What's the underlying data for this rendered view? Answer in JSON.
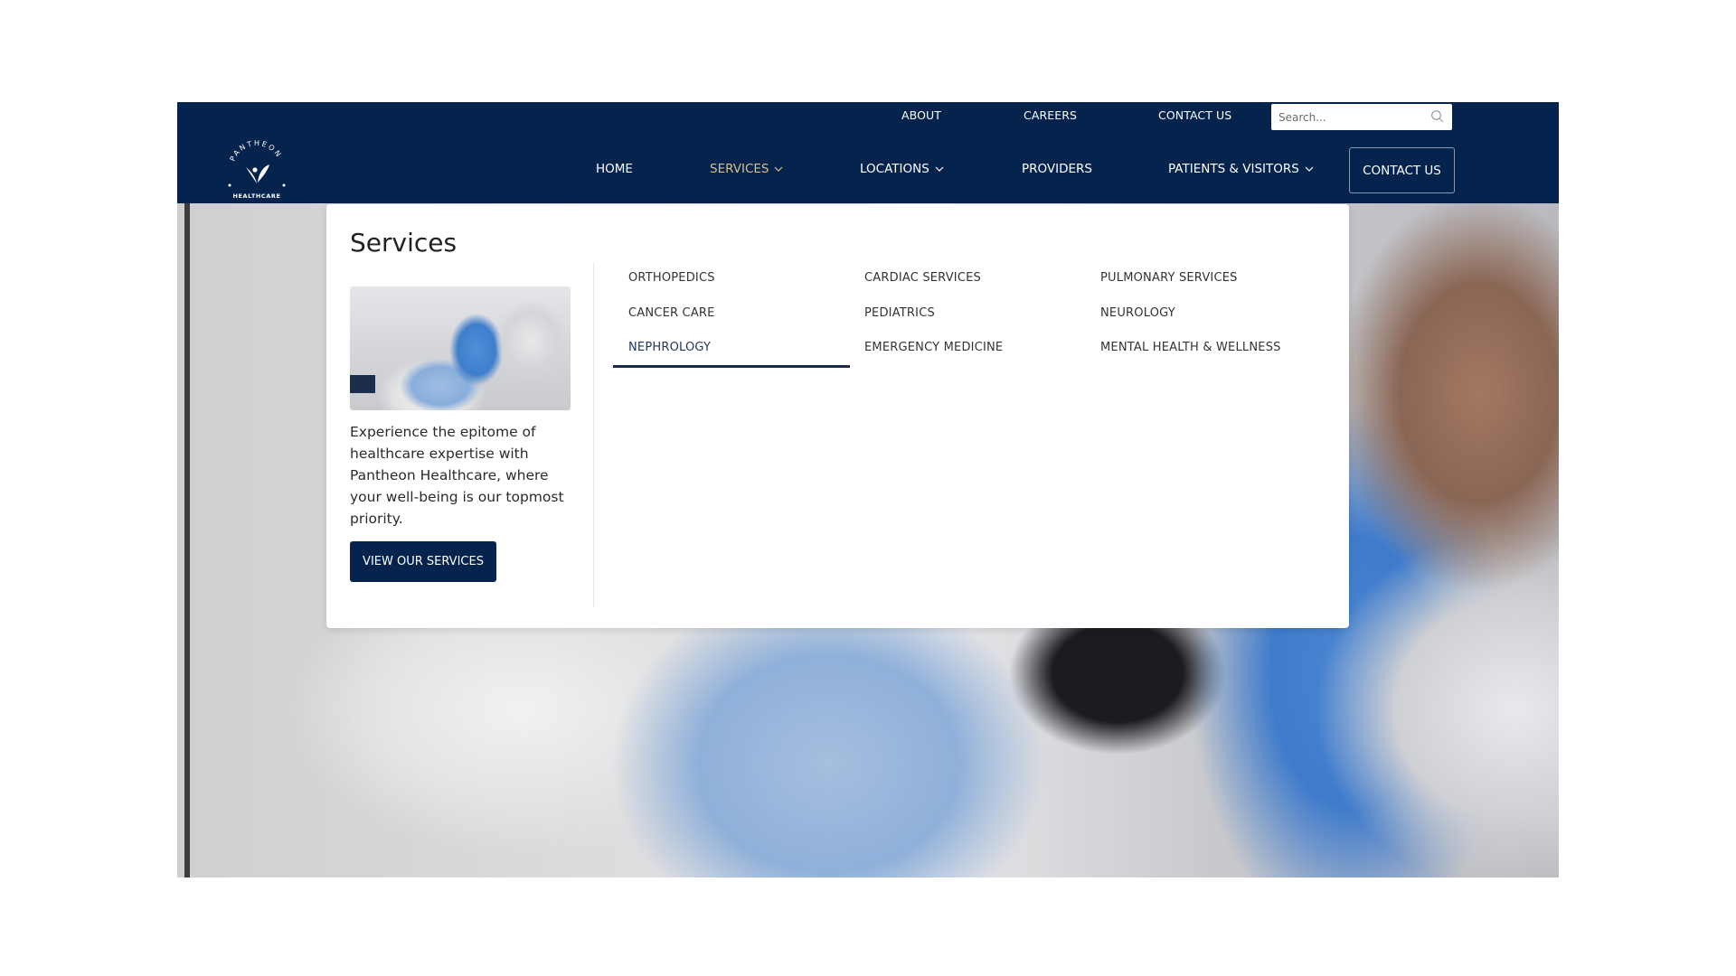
{
  "brand": {
    "name_top": "PANTHEON",
    "name_bottom": "HEALTHCARE",
    "colors": {
      "navy": "#04234d",
      "active_gold": "#d9c28a",
      "white": "#ffffff"
    }
  },
  "top_nav": {
    "items": [
      {
        "label": "ABOUT"
      },
      {
        "label": "CAREERS"
      },
      {
        "label": "CONTACT US"
      }
    ],
    "search": {
      "placeholder": "Search...",
      "value": "",
      "icon": "search-icon"
    }
  },
  "main_nav": {
    "items": [
      {
        "label": "HOME",
        "has_dropdown": false,
        "active": false
      },
      {
        "label": "SERVICES",
        "has_dropdown": true,
        "active": true
      },
      {
        "label": "LOCATIONS",
        "has_dropdown": true,
        "active": false
      },
      {
        "label": "PROVIDERS",
        "has_dropdown": false,
        "active": false
      },
      {
        "label": "PATIENTS & VISITORS",
        "has_dropdown": true,
        "active": false
      }
    ],
    "cta_label": "CONTACT US"
  },
  "services_menu": {
    "title": "Services",
    "description": "Experience the epitome of healthcare expertise with Pantheon Healthcare, where your well-being is our topmost priority.",
    "button_label": "VIEW OUR SERVICES",
    "columns": [
      [
        "ORTHOPEDICS",
        "CANCER CARE",
        "NEPHROLOGY"
      ],
      [
        "CARDIAC SERVICES",
        "PEDIATRICS",
        "EMERGENCY MEDICINE"
      ],
      [
        "PULMONARY SERVICES",
        "NEUROLOGY",
        "MENTAL HEALTH & WELLNESS"
      ]
    ],
    "hovered_item": "NEPHROLOGY"
  }
}
